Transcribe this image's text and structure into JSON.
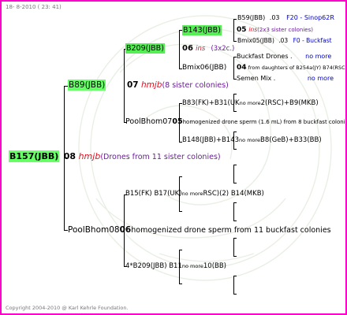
{
  "header": {
    "date": "18- 8-2010 ( 23: 41)"
  },
  "footer": {
    "copyright": "Copyright 2004-2010 @ Karl Kehrle Foundation."
  },
  "root": {
    "id": "B157(JBB)",
    "gen": "08",
    "breeder": "hmjb",
    "note": "(Drones from 11 sister colonies)"
  },
  "queen": {
    "id": "B89(JBB)",
    "gen": "07",
    "breeder": "hmjb",
    "note": "(8 sister colonies)"
  },
  "q2": {
    "id": "B209(JBB)",
    "gen": "06",
    "breeder": "ins",
    "note": "(3x2c.)"
  },
  "q3": {
    "id": "B143(JBB)",
    "gen": "05",
    "breeder": "ins",
    "note": "(2x3 sister colonies)"
  },
  "q3_right_top": {
    "id": "B59(JBB)",
    "year": ".03",
    "line": "F20 - Sinop62R"
  },
  "q3_right_bot": {
    "id": "Bmix05(JBB)",
    "year": ".03",
    "line": "F0 - Buckfast"
  },
  "mix06": {
    "id": "Bmix06(JBB)"
  },
  "mix06_r1": {
    "text": "Buckfast Drones .",
    "more": "no more"
  },
  "mix06_r2": {
    "gen": "04",
    "text": "from daughters of B254a(JY) B74(RSC) B70(RSC) ...",
    "more": ""
  },
  "mix06_r3": {
    "text": "Semen Mix .",
    "more": "no more"
  },
  "poolbhom07": {
    "label": "PoolBhom07",
    "gen": "05",
    "text": "homogenized drone sperm (1.6 mL) from 8 buckfast colonies"
  },
  "p07_r1": {
    "a": "B83(FK)+B31(UK",
    "b": "no more",
    "c": "2(RSC)+B9(MKB)"
  },
  "p07_r2": {
    "a": "B148(JBB)+B143",
    "b": "no more",
    "c": "B8(GeB)+B33(BB)"
  },
  "drone_side": {
    "row1_a": "B15(FK) B17(UK)",
    "row1_b": "no more",
    "row1_c": "RSC)(2) B14(MKB)"
  },
  "poolbhom08": {
    "label": "PoolBhom08",
    "gen": "06",
    "text": "homogenized drone sperm from 11 buckfast colonies"
  },
  "p08_r2": {
    "a": "4*B209(JBB) B11",
    "b": "no more",
    "c": "10(BB)"
  },
  "colors": {
    "frame": "#ff00cc",
    "highlight": "#66ff66",
    "red": "#e01020",
    "blue": "#0000cc",
    "purple": "#6a1b9a"
  }
}
